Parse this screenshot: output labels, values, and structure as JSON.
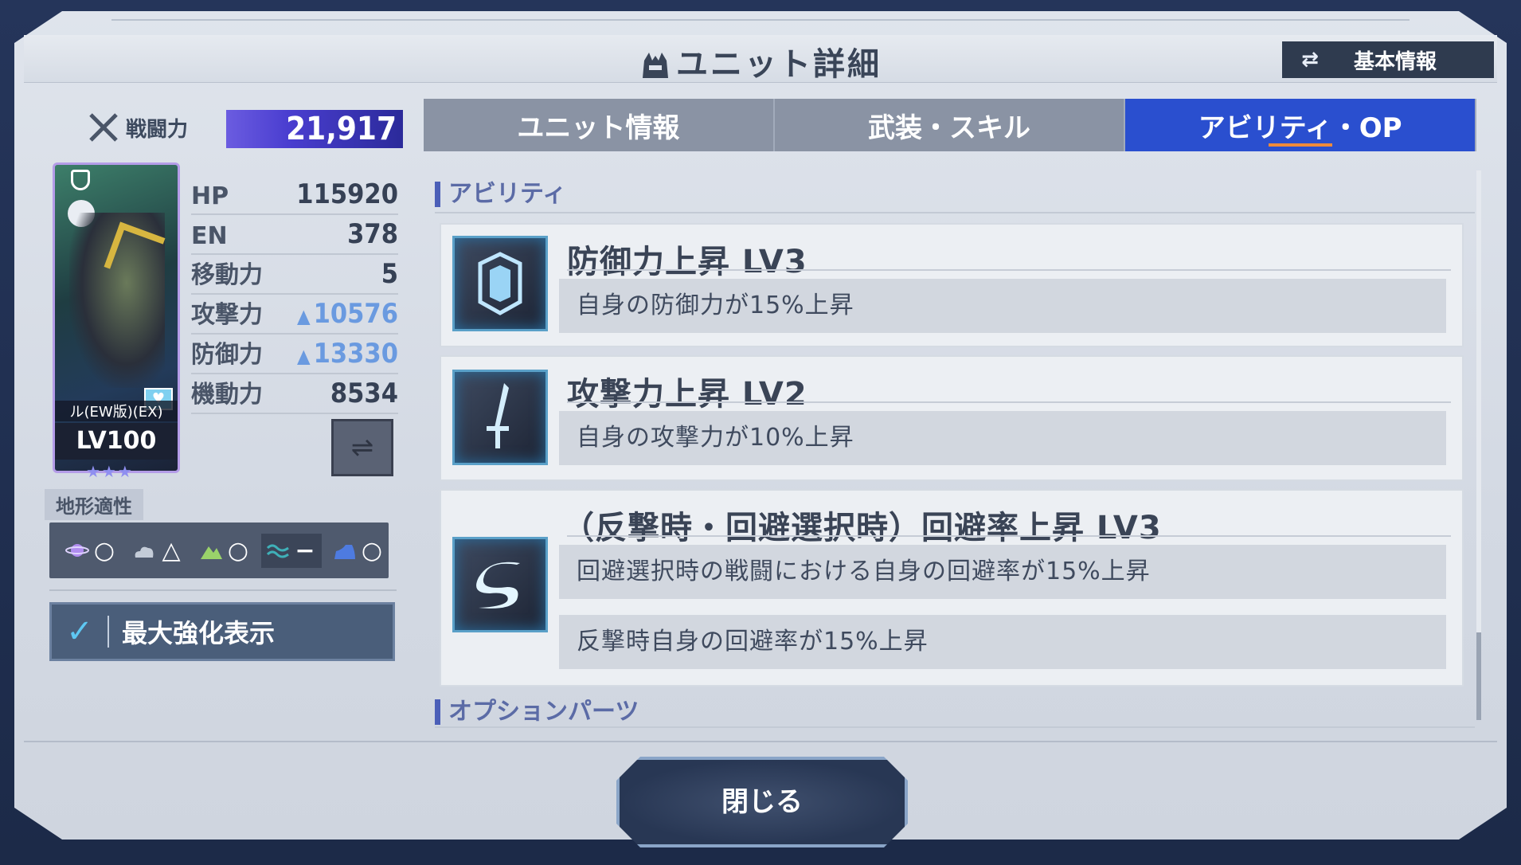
{
  "header": {
    "title": "ユニット詳細",
    "basic_info_button": "基本情報"
  },
  "left": {
    "power_label": "戦闘力",
    "power_value": "21,917",
    "card": {
      "unit_name": "ル(EW版)(EX)",
      "level": "LV100",
      "stars": "★★★"
    },
    "stats": [
      {
        "key": "HP",
        "value": "115920"
      },
      {
        "key": "EN",
        "value": "378"
      },
      {
        "key": "移動力",
        "value": "5"
      },
      {
        "key": "攻撃力",
        "value": "10576"
      },
      {
        "key": "防御力",
        "value": "13330"
      },
      {
        "key": "機動力",
        "value": "8534"
      }
    ],
    "terrain_label": "地形適性",
    "terrain": [
      {
        "type": "space",
        "rank": "○"
      },
      {
        "type": "air",
        "rank": "△"
      },
      {
        "type": "ground",
        "rank": "○"
      },
      {
        "type": "water",
        "rank": "−"
      },
      {
        "type": "underwater",
        "rank": "○"
      }
    ],
    "max_enhance_label": "最大強化表示"
  },
  "tabs": [
    {
      "label": "ユニット情報",
      "active": false
    },
    {
      "label": "武装・スキル",
      "active": false
    },
    {
      "label": "アビリティ・OP",
      "active": true
    }
  ],
  "abilities_section": "アビリティ",
  "abilities": [
    {
      "name": "防御力上昇 LV3",
      "icon": "shield-icon",
      "desc": [
        "自身の防御力が15%上昇"
      ]
    },
    {
      "name": "攻撃力上昇 LV2",
      "icon": "sword-icon",
      "desc": [
        "自身の攻撃力が10%上昇"
      ]
    },
    {
      "name": "（反撃時・回避選択時）回避率上昇 LV3",
      "icon": "evade-icon",
      "desc": [
        "回避選択時の戦闘における自身の回避率が15%上昇",
        "反撃時自身の回避率が15%上昇"
      ]
    }
  ],
  "options_section": "オプションパーツ",
  "close_button": "閉じる",
  "colors": {
    "accent": "#2a4fcf",
    "power_bar": "#4a3ed0",
    "tab_underline": "#f08a3a"
  }
}
